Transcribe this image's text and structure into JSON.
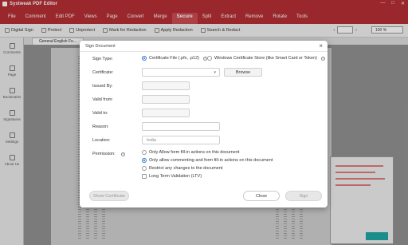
{
  "app": {
    "title": "Systweak PDF Editor"
  },
  "menu": [
    "File",
    "Comment",
    "Edit PDF",
    "Views",
    "Page",
    "Convert",
    "Merge",
    "Secure",
    "Split",
    "Extract",
    "Remove",
    "Rotate",
    "Tools"
  ],
  "menu_active": "Secure",
  "toolbar": {
    "items": [
      "Digital Sign",
      "Protect",
      "Unprotect",
      "Mark for Redaction",
      "Apply Redaction",
      "Search & Redact"
    ],
    "zoom": "100 %"
  },
  "sidebar": [
    "Comments",
    "Page",
    "Bookmarks",
    "Signatures",
    "Settings",
    "About Us"
  ],
  "doc_tab": "General English Fo...",
  "dialog": {
    "title": "Sign Document",
    "sign_type_label": "Sign Type:",
    "option_cert_file": "Certificate File (.pfx, .p12)",
    "option_windows_store": "Windows Certificate Store (like Smart Card or Token)",
    "certificate_label": "Certificate:",
    "browse": "Browse",
    "issued_by_label": "Issued By:",
    "valid_from_label": "Valid from:",
    "valid_to_label": "Valid to:",
    "reason_label": "Reason:",
    "location_label": "Location:",
    "location_value": "India",
    "permission_label": "Permission:",
    "perm_1": "Only Allow form fill-in actions on this document",
    "perm_2": "Only allow commenting and form fill-in actions on this document",
    "perm_3": "Restrict any changes to the document",
    "ltv": "Long Term Validation (LTV)",
    "show_certificate": "Show Certificate",
    "close": "Close",
    "sign": "Sign"
  }
}
